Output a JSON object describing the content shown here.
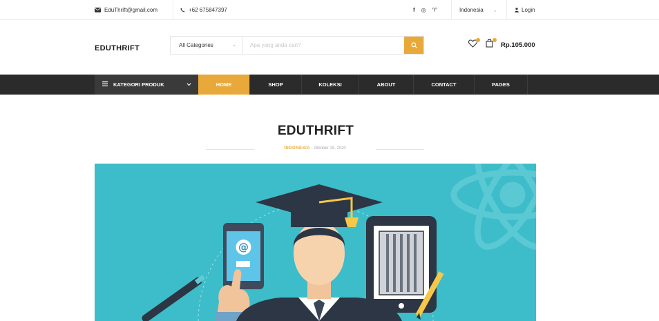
{
  "topbar": {
    "email": "EduThrift@gmail.com",
    "phone": "+62 675847397",
    "social": [
      "f",
      "◎",
      "♈"
    ],
    "language": "Indonesia",
    "login": "Login"
  },
  "header": {
    "logo": "EDUTHRIFT",
    "category_select": "All Categories",
    "search_placeholder": "Apa yang anda cari?",
    "cart_total": "Rp.105.000"
  },
  "nav": {
    "category_button": "KATEGORI PRODUK",
    "links": [
      "HOME",
      "SHOP",
      "KOLEKSI",
      "ABOUT",
      "CONTACT",
      "PAGES"
    ],
    "active": "HOME"
  },
  "post": {
    "title": "EDUTHRIFT",
    "category": "INDONESIA",
    "date": "Oktober 15, 2020"
  },
  "colors": {
    "accent": "#e8a93a",
    "nav_bg": "#2b2b2b",
    "hero_bg": "#3dbcc9"
  }
}
